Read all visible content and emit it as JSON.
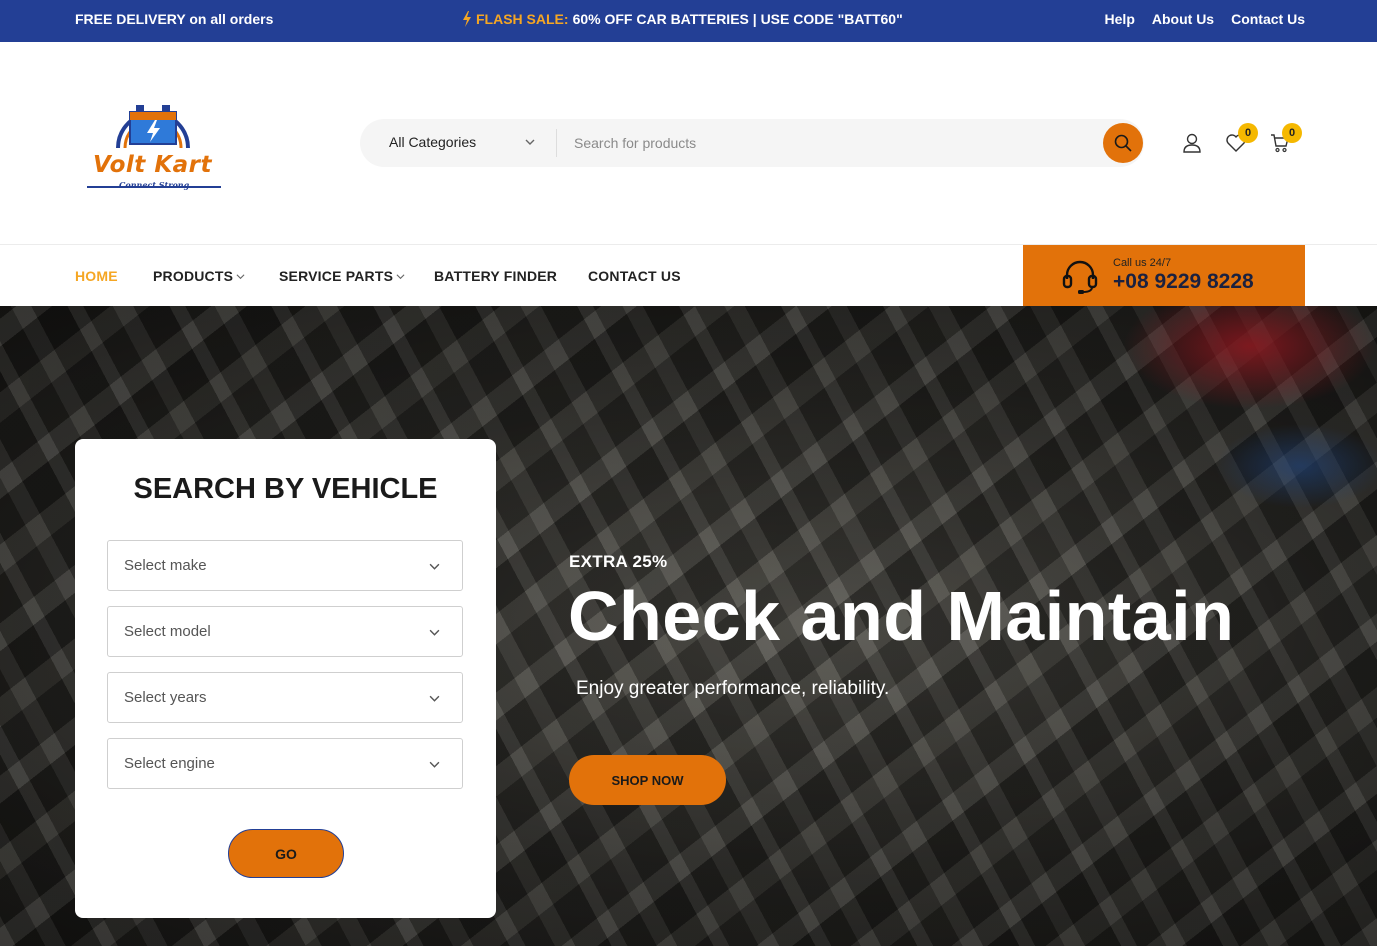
{
  "topbar": {
    "delivery": "FREE DELIVERY on all orders",
    "flash_label": "FLASH SALE:",
    "flash_text": "60% OFF CAR BATTERIES | USE CODE \"BATT60\"",
    "links": [
      "Help",
      "About Us",
      "Contact Us"
    ]
  },
  "logo": {
    "word_a": "Volt",
    "word_b": "Kart",
    "tagline": "Connect Strong"
  },
  "search": {
    "category": "All Categories",
    "placeholder": "Search for products"
  },
  "header_icons": {
    "wishlist_count": "0",
    "cart_count": "0"
  },
  "nav": {
    "items": [
      "HOME",
      "PRODUCTS",
      "SERVICE PARTS",
      "BATTERY FINDER",
      "CONTACT US"
    ],
    "call_label": "Call us 24/7",
    "call_number": "+08 9229 8228"
  },
  "hero": {
    "sub": "EXTRA 25%",
    "title": "Check and Maintain",
    "desc": "Enjoy greater performance, reliability.",
    "cta": "SHOP NOW"
  },
  "vehicle_search": {
    "title": "SEARCH BY VEHICLE",
    "selects": [
      "Select make",
      "Select model",
      "Select years",
      "Select engine"
    ],
    "go": "GO"
  },
  "colors": {
    "topbar_bg": "#233f95",
    "accent_orange": "#e2720a",
    "flash_yellow": "#f5a623",
    "badge_yellow": "#f5b800"
  },
  "icons": [
    "bolt-icon",
    "chevron-down-icon",
    "search-icon",
    "user-icon",
    "heart-icon",
    "cart-icon",
    "headset-icon",
    "battery-icon"
  ]
}
